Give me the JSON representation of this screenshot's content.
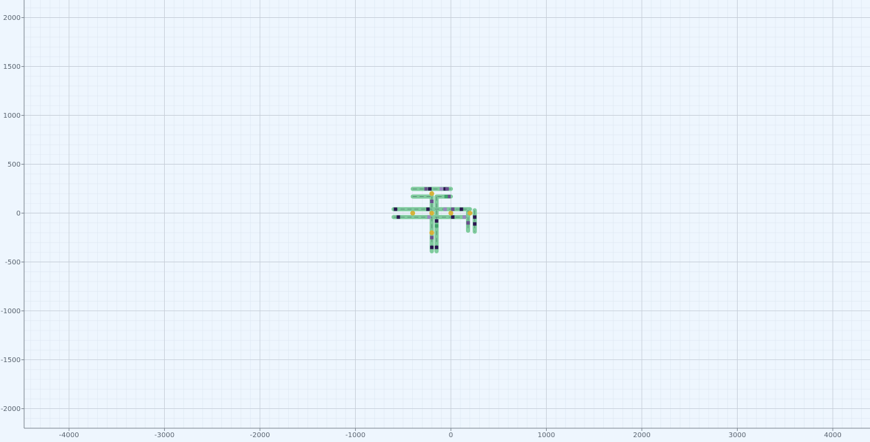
{
  "viewport": {
    "x_axis": {
      "min": -4470,
      "max": 4390,
      "major_step": 1000,
      "minor_step": 100,
      "tick_labels": [
        "-4000",
        "-3000",
        "-2000",
        "-1000",
        "0",
        "1000",
        "2000",
        "3000",
        "4000"
      ]
    },
    "y_axis": {
      "min": -2200,
      "max": 2180,
      "major_step": 500,
      "minor_step": 100,
      "tick_labels": [
        "2000",
        "1500",
        "1000",
        "500",
        "0",
        "-500",
        "-1000",
        "-1500",
        "-2000"
      ]
    },
    "colors": {
      "background": "#eef6fe",
      "grid_minor": "#dde7f1",
      "grid_major": "#c4ccd6",
      "axis_line": "#7a848e",
      "road": "#7fcb9d",
      "lane_line": "#2f4050",
      "junction": "#d6b23a",
      "vehicle_dark": "#2a1650",
      "vehicle_mid": "#6a4e8e",
      "vehicle_light": "#9b86c2",
      "vehicle_green": "#3fa36a"
    }
  },
  "scene": {
    "roads": [
      {
        "from": [
          -400,
          248
        ],
        "to": [
          0,
          248
        ]
      },
      {
        "from": [
          -400,
          170
        ],
        "to": [
          -200,
          170
        ]
      },
      {
        "from": [
          -200,
          170
        ],
        "to": [
          -200,
          -390
        ]
      },
      {
        "from": [
          -150,
          170
        ],
        "to": [
          -150,
          -390
        ]
      },
      {
        "from": [
          -140,
          170
        ],
        "to": [
          0,
          170
        ]
      },
      {
        "from": [
          -600,
          40
        ],
        "to": [
          200,
          40
        ]
      },
      {
        "from": [
          -600,
          -40
        ],
        "to": [
          180,
          -40
        ]
      },
      {
        "from": [
          180,
          30
        ],
        "to": [
          180,
          -180
        ]
      },
      {
        "from": [
          250,
          30
        ],
        "to": [
          250,
          -190
        ]
      }
    ],
    "junctions": [
      [
        -200,
        200
      ],
      [
        -400,
        0
      ],
      [
        -200,
        0
      ],
      [
        0,
        0
      ],
      [
        200,
        0
      ],
      [
        -200,
        -200
      ]
    ],
    "vehicles": [
      {
        "pos": [
          -260,
          248
        ],
        "tone": "vehicle_mid"
      },
      {
        "pos": [
          -220,
          248
        ],
        "tone": "vehicle_dark"
      },
      {
        "pos": [
          -100,
          248
        ],
        "tone": "vehicle_light"
      },
      {
        "pos": [
          -60,
          248
        ],
        "tone": "vehicle_dark"
      },
      {
        "pos": [
          -40,
          248
        ],
        "tone": "vehicle_mid"
      },
      {
        "pos": [
          -20,
          170
        ],
        "tone": "vehicle_mid"
      },
      {
        "pos": [
          -50,
          170
        ],
        "tone": "vehicle_green"
      },
      {
        "pos": [
          -580,
          40
        ],
        "tone": "vehicle_dark"
      },
      {
        "pos": [
          -240,
          40
        ],
        "tone": "vehicle_dark"
      },
      {
        "pos": [
          -60,
          40
        ],
        "tone": "vehicle_light"
      },
      {
        "pos": [
          20,
          40
        ],
        "tone": "vehicle_mid"
      },
      {
        "pos": [
          110,
          40
        ],
        "tone": "vehicle_dark"
      },
      {
        "pos": [
          -550,
          -40
        ],
        "tone": "vehicle_dark"
      },
      {
        "pos": [
          -230,
          -40
        ],
        "tone": "vehicle_light"
      },
      {
        "pos": [
          20,
          -40
        ],
        "tone": "vehicle_dark"
      },
      {
        "pos": [
          140,
          -40
        ],
        "tone": "vehicle_light"
      },
      {
        "pos": [
          250,
          -40
        ],
        "tone": "vehicle_dark"
      },
      {
        "pos": [
          -200,
          120
        ],
        "tone": "vehicle_mid"
      },
      {
        "pos": [
          -200,
          -250
        ],
        "tone": "vehicle_mid"
      },
      {
        "pos": [
          -200,
          -350
        ],
        "tone": "vehicle_dark"
      },
      {
        "pos": [
          -150,
          -80
        ],
        "tone": "vehicle_dark"
      },
      {
        "pos": [
          -150,
          -130
        ],
        "tone": "vehicle_green"
      },
      {
        "pos": [
          -150,
          -350
        ],
        "tone": "vehicle_dark"
      },
      {
        "pos": [
          180,
          -100
        ],
        "tone": "vehicle_mid"
      },
      {
        "pos": [
          250,
          -110
        ],
        "tone": "vehicle_dark"
      }
    ]
  }
}
